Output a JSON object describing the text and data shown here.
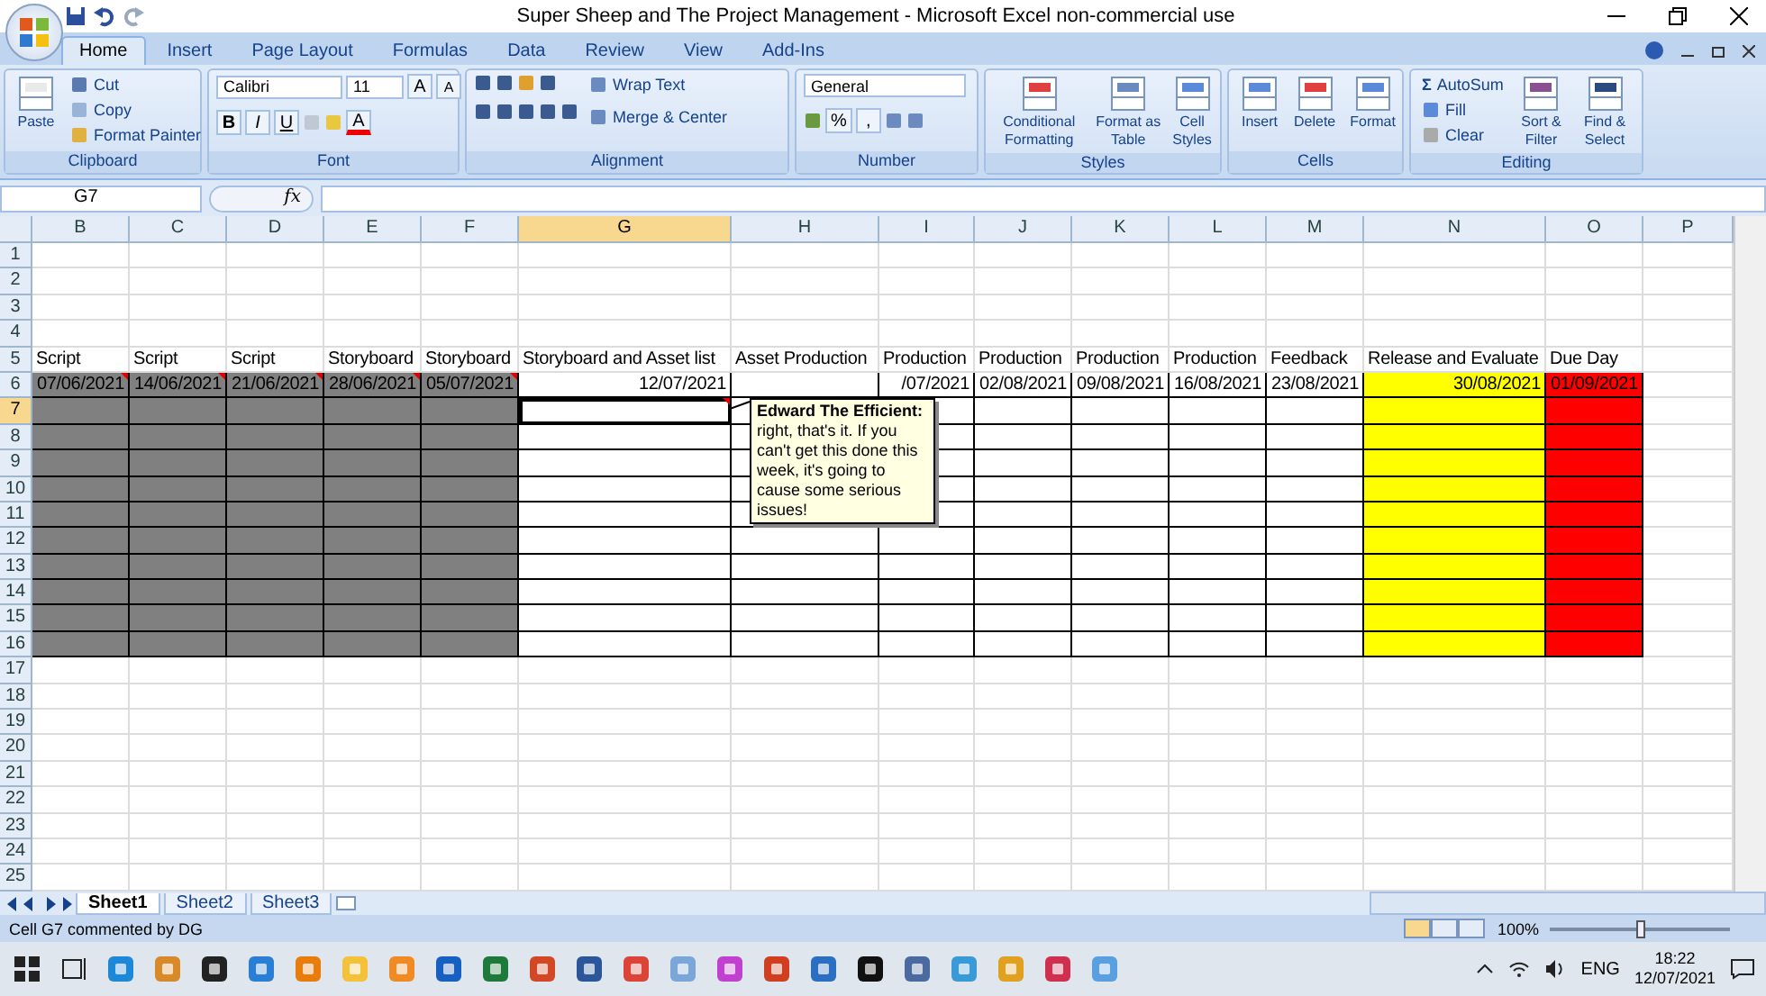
{
  "window": {
    "title": "Super Sheep and The Project Management - Microsoft Excel non-commercial use"
  },
  "tabs": [
    {
      "label": "Home",
      "selected": true
    },
    {
      "label": "Insert",
      "selected": false
    },
    {
      "label": "Page Layout",
      "selected": false
    },
    {
      "label": "Formulas",
      "selected": false
    },
    {
      "label": "Data",
      "selected": false
    },
    {
      "label": "Review",
      "selected": false
    },
    {
      "label": "View",
      "selected": false
    },
    {
      "label": "Add-Ins",
      "selected": false
    }
  ],
  "ribbon": {
    "clipboard": {
      "title": "Clipboard",
      "paste": "Paste",
      "cut": "Cut",
      "copy": "Copy",
      "format_painter": "Format Painter"
    },
    "font": {
      "title": "Font",
      "font_name": "Calibri",
      "font_size": "11",
      "grow": "A",
      "shrink": "A",
      "bold": "B",
      "italic": "I",
      "underline": "U",
      "font_color": "A"
    },
    "alignment": {
      "title": "Alignment",
      "wrap_text": "Wrap Text",
      "merge_center": "Merge & Center"
    },
    "number": {
      "title": "Number",
      "format": "General",
      "percent": "%",
      "comma": ","
    },
    "styles": {
      "title": "Styles",
      "buttons": [
        "Conditional Formatting",
        "Format as Table",
        "Cell Styles"
      ]
    },
    "cells": {
      "title": "Cells",
      "buttons": [
        "Insert",
        "Delete",
        "Format"
      ]
    },
    "editing": {
      "title": "Editing",
      "autosum_symbol": "Σ",
      "autosum": "AutoSum",
      "fill": "Fill",
      "clear": "Clear",
      "buttons": [
        "Sort & Filter",
        "Find & Select"
      ]
    }
  },
  "formula_bar": {
    "name_box": "G7",
    "function_symbol": "fx"
  },
  "columns": [
    {
      "letter": "B",
      "selected": false
    },
    {
      "letter": "C",
      "selected": false
    },
    {
      "letter": "D",
      "selected": false
    },
    {
      "letter": "E",
      "selected": false
    },
    {
      "letter": "F",
      "selected": false
    },
    {
      "letter": "G",
      "selected": true
    },
    {
      "letter": "H",
      "selected": false
    },
    {
      "letter": "I",
      "selected": false
    },
    {
      "letter": "J",
      "selected": false
    },
    {
      "letter": "K",
      "selected": false
    },
    {
      "letter": "L",
      "selected": false
    },
    {
      "letter": "M",
      "selected": false
    },
    {
      "letter": "N",
      "selected": false
    },
    {
      "letter": "O",
      "selected": false
    },
    {
      "letter": "P",
      "selected": false
    }
  ],
  "rows": [
    {
      "number": "1",
      "selected": false,
      "bordered": false
    },
    {
      "number": "2",
      "selected": false,
      "bordered": false
    },
    {
      "number": "3",
      "selected": false,
      "bordered": false
    },
    {
      "number": "4",
      "selected": false,
      "bordered": false
    },
    {
      "number": "5",
      "selected": false,
      "bordered": false,
      "cells": [
        {
          "text": "Script"
        },
        {
          "text": "Script"
        },
        {
          "text": "Script"
        },
        {
          "text": "Storyboard"
        },
        {
          "text": "Storyboard"
        },
        {
          "text": "Storyboard and Asset list"
        },
        {
          "text": "Asset Production"
        },
        {
          "text": "Production"
        },
        {
          "text": "Production"
        },
        {
          "text": "Production"
        },
        {
          "text": "Production"
        },
        {
          "text": "Feedback"
        },
        {
          "text": "Release and Evaluate"
        },
        {
          "text": "Due Day"
        },
        {}
      ]
    },
    {
      "number": "6",
      "selected": false,
      "bordered": true,
      "cells": [
        {
          "text": "07/06/2021",
          "color": "#808080",
          "comment": true
        },
        {
          "text": "14/06/2021",
          "color": "#808080",
          "comment": true
        },
        {
          "text": "21/06/2021",
          "color": "#808080",
          "comment": true
        },
        {
          "text": "28/06/2021",
          "color": "#808080",
          "comment": true
        },
        {
          "text": "05/07/2021",
          "color": "#808080",
          "comment": true
        },
        {
          "text": "12/07/2021"
        },
        {},
        {
          "text": "/07/2021"
        },
        {
          "text": "02/08/2021"
        },
        {
          "text": "09/08/2021"
        },
        {
          "text": "16/08/2021"
        },
        {
          "text": "23/08/2021"
        },
        {
          "text": "30/08/2021",
          "color": "#ffff00"
        },
        {
          "text": "01/09/2021",
          "color": "#ff0000"
        },
        {}
      ]
    },
    {
      "number": "7",
      "selected": true,
      "bordered": true,
      "cells": [
        {
          "color": "#808080"
        },
        {
          "color": "#808080"
        },
        {
          "color": "#808080"
        },
        {
          "color": "#808080"
        },
        {
          "color": "#808080"
        },
        {
          "active": true,
          "comment": true
        },
        {},
        {},
        {},
        {},
        {},
        {},
        {
          "color": "#ffff00"
        },
        {
          "color": "#ff0000"
        },
        {}
      ]
    },
    {
      "number": "8",
      "selected": false,
      "bordered": true,
      "cells": [
        {
          "color": "#808080"
        },
        {
          "color": "#808080"
        },
        {
          "color": "#808080"
        },
        {
          "color": "#808080"
        },
        {
          "color": "#808080"
        },
        {},
        {},
        {},
        {},
        {},
        {},
        {},
        {
          "color": "#ffff00"
        },
        {
          "color": "#ff0000"
        },
        {}
      ]
    },
    {
      "number": "9",
      "selected": false,
      "bordered": true,
      "cells": [
        {
          "color": "#808080"
        },
        {
          "color": "#808080"
        },
        {
          "color": "#808080"
        },
        {
          "color": "#808080"
        },
        {
          "color": "#808080"
        },
        {},
        {},
        {},
        {},
        {},
        {},
        {},
        {
          "color": "#ffff00"
        },
        {
          "color": "#ff0000"
        },
        {}
      ]
    },
    {
      "number": "10",
      "selected": false,
      "bordered": true,
      "cells": [
        {
          "color": "#808080"
        },
        {
          "color": "#808080"
        },
        {
          "color": "#808080"
        },
        {
          "color": "#808080"
        },
        {
          "color": "#808080"
        },
        {},
        {},
        {},
        {},
        {},
        {},
        {},
        {
          "color": "#ffff00"
        },
        {
          "color": "#ff0000"
        },
        {}
      ]
    },
    {
      "number": "11",
      "selected": false,
      "bordered": true,
      "cells": [
        {
          "color": "#808080"
        },
        {
          "color": "#808080"
        },
        {
          "color": "#808080"
        },
        {
          "color": "#808080"
        },
        {
          "color": "#808080"
        },
        {},
        {},
        {},
        {},
        {},
        {},
        {},
        {
          "color": "#ffff00"
        },
        {
          "color": "#ff0000"
        },
        {}
      ]
    },
    {
      "number": "12",
      "selected": false,
      "bordered": true,
      "cells": [
        {
          "color": "#808080"
        },
        {
          "color": "#808080"
        },
        {
          "color": "#808080"
        },
        {
          "color": "#808080"
        },
        {
          "color": "#808080"
        },
        {},
        {},
        {},
        {},
        {},
        {},
        {},
        {
          "color": "#ffff00"
        },
        {
          "color": "#ff0000"
        },
        {}
      ]
    },
    {
      "number": "13",
      "selected": false,
      "bordered": true,
      "cells": [
        {
          "color": "#808080"
        },
        {
          "color": "#808080"
        },
        {
          "color": "#808080"
        },
        {
          "color": "#808080"
        },
        {
          "color": "#808080"
        },
        {},
        {},
        {},
        {},
        {},
        {},
        {},
        {
          "color": "#ffff00"
        },
        {
          "color": "#ff0000"
        },
        {}
      ]
    },
    {
      "number": "14",
      "selected": false,
      "bordered": true,
      "cells": [
        {
          "color": "#808080"
        },
        {
          "color": "#808080"
        },
        {
          "color": "#808080"
        },
        {
          "color": "#808080"
        },
        {
          "color": "#808080"
        },
        {},
        {},
        {},
        {},
        {},
        {},
        {},
        {
          "color": "#ffff00"
        },
        {
          "color": "#ff0000"
        },
        {}
      ]
    },
    {
      "number": "15",
      "selected": false,
      "bordered": true,
      "cells": [
        {
          "color": "#808080"
        },
        {
          "color": "#808080"
        },
        {
          "color": "#808080"
        },
        {
          "color": "#808080"
        },
        {
          "color": "#808080"
        },
        {},
        {},
        {},
        {},
        {},
        {},
        {},
        {
          "color": "#ffff00"
        },
        {
          "color": "#ff0000"
        },
        {}
      ]
    },
    {
      "number": "16",
      "selected": false,
      "bordered": true,
      "cells": [
        {
          "color": "#808080"
        },
        {
          "color": "#808080"
        },
        {
          "color": "#808080"
        },
        {
          "color": "#808080"
        },
        {
          "color": "#808080"
        },
        {},
        {},
        {},
        {},
        {},
        {},
        {},
        {
          "color": "#ffff00"
        },
        {
          "color": "#ff0000"
        },
        {}
      ]
    },
    {
      "number": "17",
      "selected": false,
      "bordered": false
    },
    {
      "number": "18",
      "selected": false,
      "bordered": false
    },
    {
      "number": "19",
      "selected": false,
      "bordered": false
    },
    {
      "number": "20",
      "selected": false,
      "bordered": false
    },
    {
      "number": "21",
      "selected": false,
      "bordered": false
    },
    {
      "number": "22",
      "selected": false,
      "bordered": false
    },
    {
      "number": "23",
      "selected": false,
      "bordered": false
    },
    {
      "number": "24",
      "selected": false,
      "bordered": false
    },
    {
      "number": "25",
      "selected": false,
      "bordered": false
    }
  ],
  "comment": {
    "text": "**Edward The Efficient:** right, that's it. If you can't get this done this week, it's going to cause some serious issues!"
  },
  "sheet_tabs": [
    {
      "label": "Sheet1",
      "selected": true
    },
    {
      "label": "Sheet2",
      "selected": false
    },
    {
      "label": "Sheet3",
      "selected": false
    }
  ],
  "status_bar": {
    "message": "Cell G7 commented by DG",
    "zoom": "100%",
    "zoom_slider": {
      "level": 0.5
    }
  },
  "taskbar": {
    "language": "ENG",
    "time": "18:22",
    "date": "12/07/2021"
  }
}
